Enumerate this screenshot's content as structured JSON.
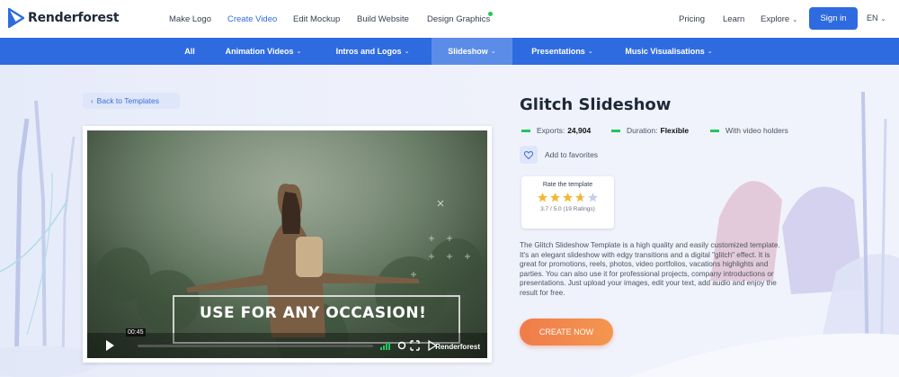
{
  "header": {
    "brand": "Renderforest",
    "nav": [
      "Make Logo",
      "Create Video",
      "Edit Mockup",
      "Build Website",
      "Design Graphics"
    ],
    "active_nav": "Create Video",
    "right": {
      "pricing": "Pricing",
      "learn": "Learn",
      "explore": "Explore",
      "signin": "Sign in",
      "lang": "EN"
    }
  },
  "categories": [
    {
      "label": "All",
      "chevron": false
    },
    {
      "label": "Animation Videos",
      "chevron": true
    },
    {
      "label": "Intros and Logos",
      "chevron": true
    },
    {
      "label": "Slideshow",
      "chevron": true
    },
    {
      "label": "Presentations",
      "chevron": true
    },
    {
      "label": "Music Visualisations",
      "chevron": true
    }
  ],
  "active_category": "Slideshow",
  "back_label": "Back to Templates",
  "player": {
    "overlay_text": "USE FOR ANY OCCASION!",
    "timecode": "00:45",
    "watermark": "Renderforest"
  },
  "template": {
    "title": "Glitch Slideshow",
    "exports_label": "Exports:",
    "exports_value": "24,904",
    "duration_label": "Duration:",
    "duration_value": "Flexible",
    "holders": "With video holders",
    "favorites": "Add to favorites"
  },
  "rating": {
    "label": "Rate the template",
    "value": 3.7,
    "text": "3.7 / 5.0 (19 Ratings)"
  },
  "description": "The Glitch Slideshow Template is a high quality and easily customized template. It's an elegant slideshow with edgy transitions and a digital \"glitch\" effect. It is great for promotions, reels, photos, video portfolios, vacations highlights and parties. You can also use it for professional projects, company introductions or presentations. Just upload your images, edit your text, add audio and enjoy the result for free.",
  "cta": "CREATE NOW",
  "colors": {
    "accent": "#2f6be0",
    "status_green": "#22c55e",
    "cta": "#f07c4b"
  }
}
